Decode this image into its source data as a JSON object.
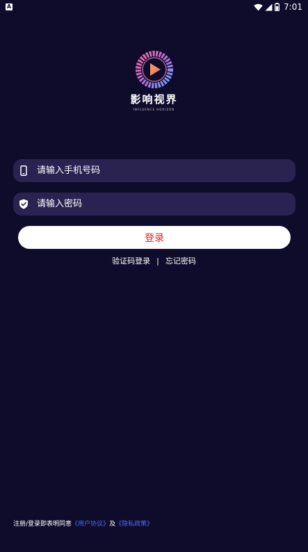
{
  "status_bar": {
    "notification_icon": "A",
    "time": "7:01",
    "icons": [
      "wifi-icon",
      "signal-icon",
      "battery-icon"
    ]
  },
  "logo": {
    "title": "影响视界",
    "subtitle": "INFLUENCE HORIZON"
  },
  "login_form": {
    "phone_placeholder": "请输入手机号码",
    "phone_value": "",
    "password_placeholder": "请输入密码",
    "password_value": "",
    "login_label": "登录"
  },
  "links": {
    "sms_login": "验证码登录",
    "separator": "|",
    "forgot_password": "忘记密码"
  },
  "agreement": {
    "prefix": "注册/登录即表明同意",
    "user_agreement": "《用户协议》",
    "conjunction": "及",
    "privacy_policy": "《隐私政策》"
  },
  "colors": {
    "background": "#0f0b2a",
    "field_background": "#2a2250",
    "login_text": "#e0222a",
    "link_blue": "#4a6dff"
  }
}
